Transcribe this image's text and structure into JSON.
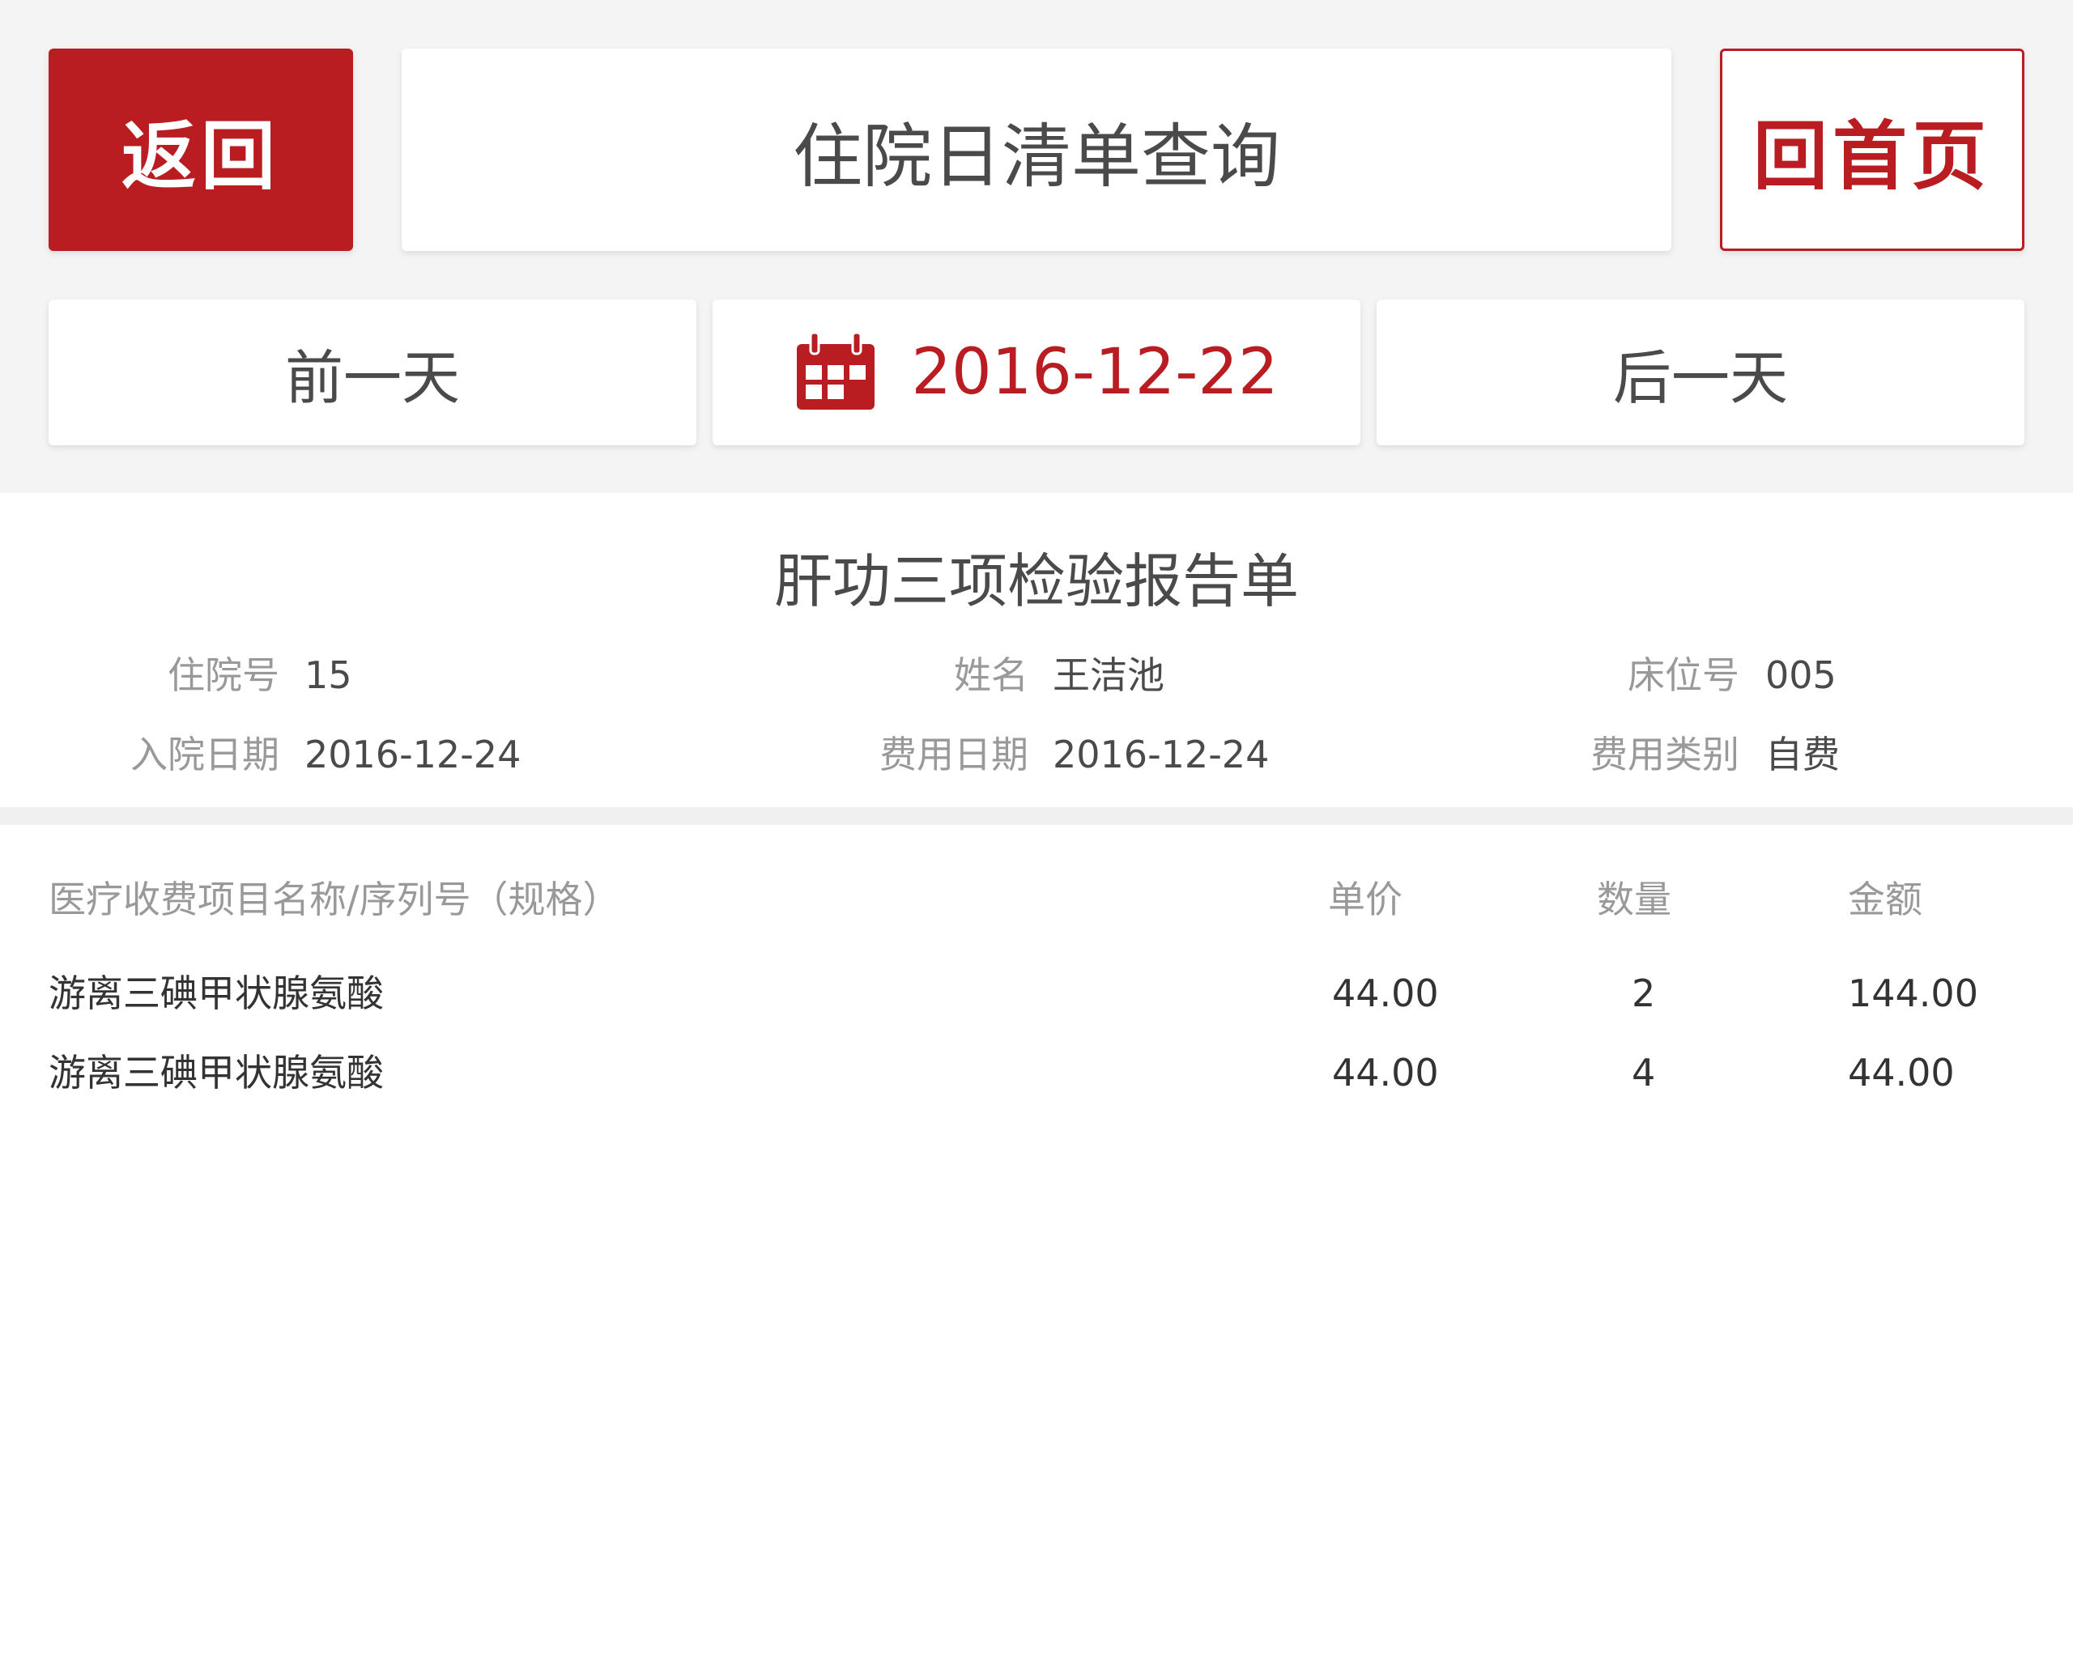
{
  "header": {
    "back_label": "返回",
    "title": "住院日清单查询",
    "home_label": "回首页"
  },
  "date_nav": {
    "prev_label": "前一天",
    "current_date": "2016-12-22",
    "next_label": "后一天",
    "calendar_icon": "calendar-icon"
  },
  "report": {
    "title": "肝功三项检验报告单",
    "admission_no_label": "住院号",
    "admission_no": "15",
    "name_label": "姓名",
    "name": "王洁池",
    "bed_no_label": "床位号",
    "bed_no": "005",
    "admission_date_label": "入院日期",
    "admission_date": "2016-12-24",
    "fee_date_label": "费用日期",
    "fee_date": "2016-12-24",
    "fee_type_label": "费用类别",
    "fee_type": "自费"
  },
  "table": {
    "headers": {
      "name": "医疗收费项目名称/序列号（规格）",
      "price": "单价",
      "qty": "数量",
      "amount": "金额"
    },
    "rows": [
      {
        "name": "游离三碘甲状腺氨酸",
        "price": "44.00",
        "qty": "2",
        "amount": "144.00"
      },
      {
        "name": "游离三碘甲状腺氨酸",
        "price": "44.00",
        "qty": "4",
        "amount": "44.00"
      }
    ]
  },
  "colors": {
    "accent": "#b91c21",
    "background": "#f4f4f4",
    "label": "#999999",
    "text": "#333333"
  }
}
